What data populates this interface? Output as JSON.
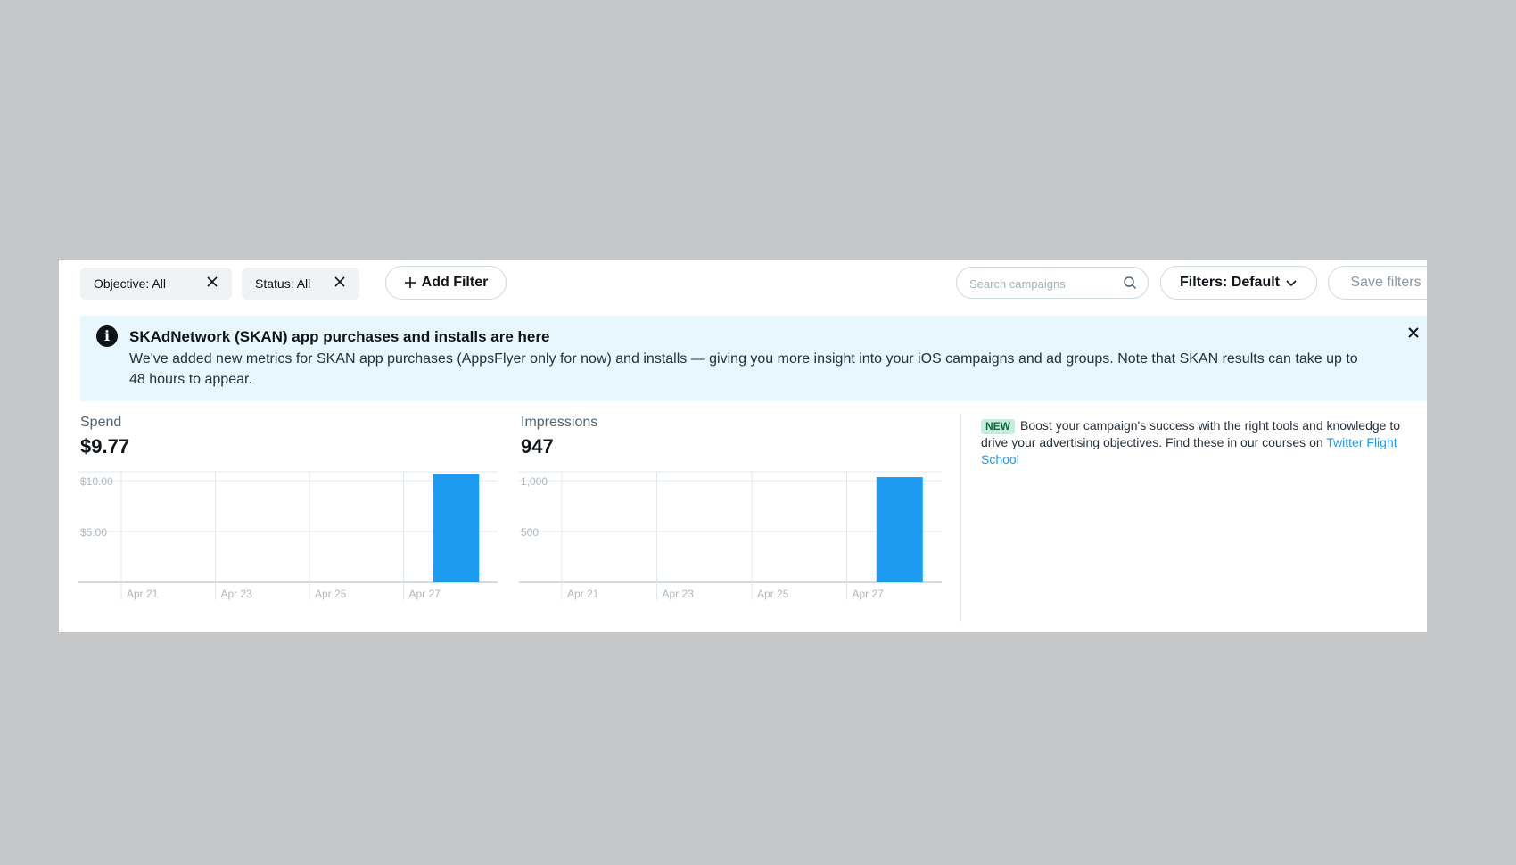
{
  "filters": {
    "objective_chip": "Objective: All",
    "status_chip": "Status: All",
    "add_filter": "Add Filter",
    "search_placeholder": "Search campaigns",
    "filters_dropdown": "Filters: Default",
    "save_filters": "Save filters"
  },
  "banner": {
    "info_glyph": "i",
    "title": "SKAdNetwork (SKAN) app purchases and installs are here",
    "body": "We've added new metrics for SKAN app purchases (AppsFlyer only for now) and installs — giving you more insight into your iOS campaigns and ad groups. Note that SKAN results can take up to 48 hours to appear."
  },
  "metrics": {
    "spend": {
      "label": "Spend",
      "value": "$9.77"
    },
    "impressions": {
      "label": "Impressions",
      "value": "947"
    }
  },
  "promo": {
    "badge": "NEW",
    "text": "Boost your campaign's success with the right tools and knowledge to drive your advertising objectives. Find these in our courses on",
    "link": "Twitter Flight School"
  },
  "colors": {
    "bar": "#1d9bf0",
    "grid": "#e1e8ed",
    "banner": "#e8f6fd"
  },
  "chart_data": [
    {
      "type": "bar",
      "title": "Spend",
      "categories": [
        "Apr 21",
        "Apr 23",
        "Apr 25",
        "Apr 27"
      ],
      "values": [
        0,
        0,
        0,
        9.77
      ],
      "y_ticks": [
        "$10.00",
        "$5.00"
      ],
      "ylim": [
        0,
        10
      ]
    },
    {
      "type": "bar",
      "title": "Impressions",
      "categories": [
        "Apr 21",
        "Apr 23",
        "Apr 25",
        "Apr 27"
      ],
      "values": [
        0,
        0,
        0,
        947
      ],
      "y_ticks": [
        "1,000",
        "500"
      ],
      "ylim": [
        0,
        1000
      ]
    }
  ]
}
